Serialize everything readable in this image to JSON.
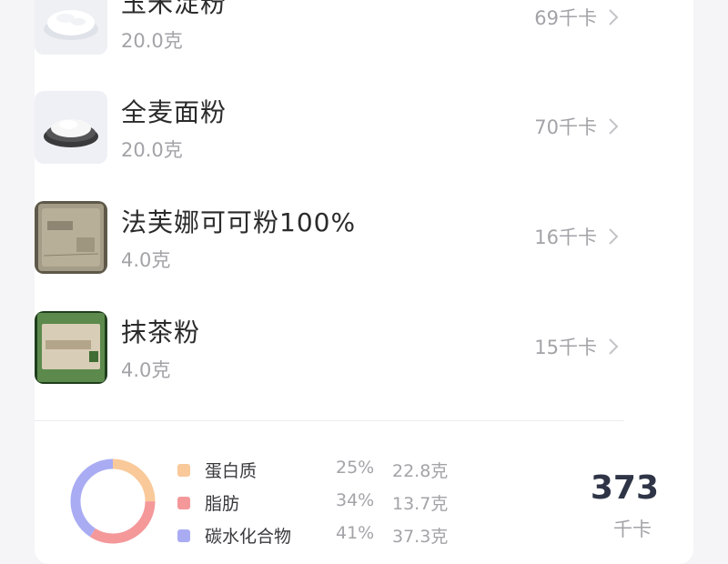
{
  "food_items": [
    {
      "name": "玉米淀粉",
      "amount": "20.0克",
      "kcal": "69千卡",
      "thumbnail_icon": "corn-starch-image"
    },
    {
      "name": "全麦面粉",
      "amount": "20.0克",
      "kcal": "70千卡",
      "thumbnail_icon": "whole-wheat-flour-image"
    },
    {
      "name": "法芙娜可可粉100%",
      "amount": "4.0克",
      "kcal": "16千卡",
      "thumbnail_icon": "cocoa-powder-package-image"
    },
    {
      "name": "抹茶粉",
      "amount": "4.0克",
      "kcal": "15千卡",
      "thumbnail_icon": "matcha-powder-package-image"
    }
  ],
  "nutrition": {
    "macros": [
      {
        "name": "蛋白质",
        "percent": "25%",
        "grams": "22.8克",
        "share": 25,
        "color": "#f9c99a"
      },
      {
        "name": "脂肪",
        "percent": "34%",
        "grams": "13.7克",
        "share": 34,
        "color": "#f4989a"
      },
      {
        "name": "碳水化合物",
        "percent": "41%",
        "grams": "37.3克",
        "share": 41,
        "color": "#a9acf3"
      }
    ],
    "total_value": "373",
    "total_unit": "千卡"
  }
}
